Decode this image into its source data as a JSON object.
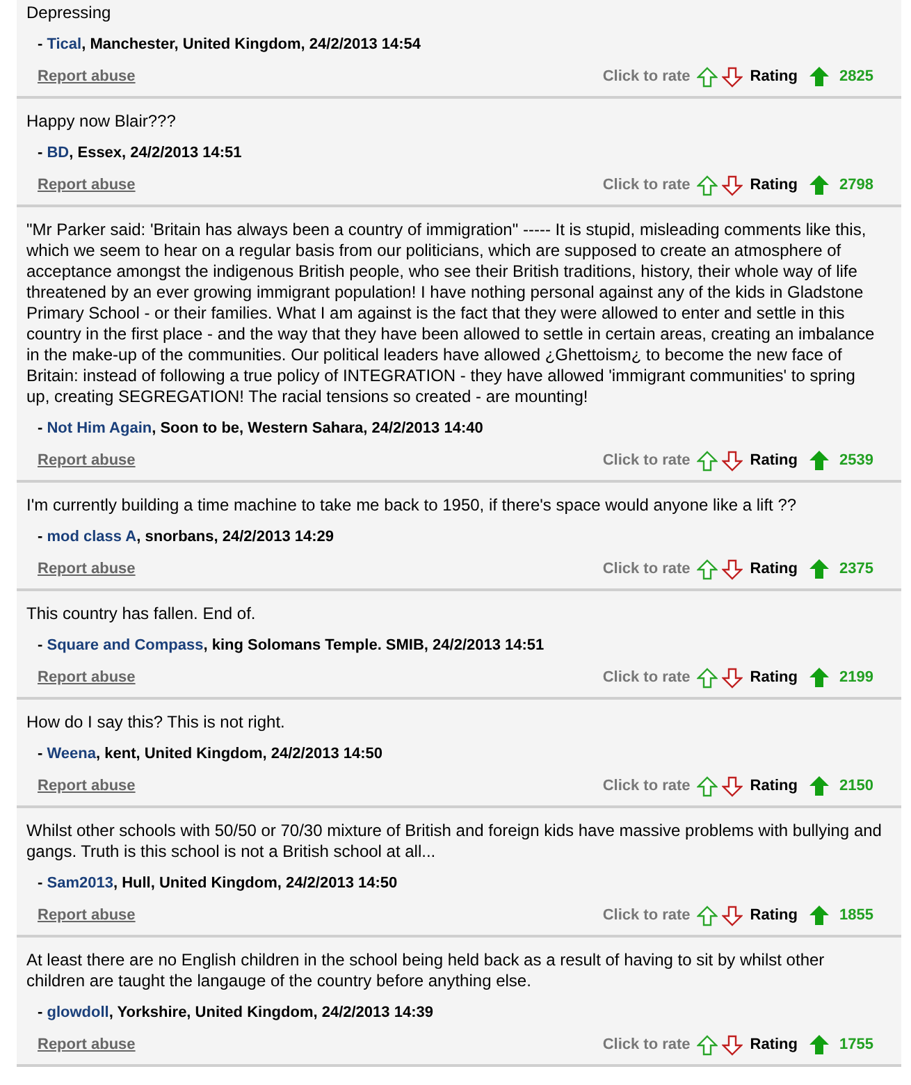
{
  "comments": [
    {
      "dash": "-",
      "text": "Depressing",
      "author": "Tical",
      "details": ", Manchester, United Kingdom, 24/2/2013 14:54",
      "report": "Report abuse",
      "rate_label": "Click to rate",
      "rating_label": "Rating",
      "rating": "2825"
    },
    {
      "dash": "-",
      "text": "Happy now Blair???",
      "author": "BD",
      "details": ", Essex, 24/2/2013 14:51",
      "report": "Report abuse",
      "rate_label": "Click to rate",
      "rating_label": "Rating",
      "rating": "2798"
    },
    {
      "dash": "-",
      "text": "\"Mr Parker said: 'Britain has always been a country of immigration\" ----- It is stupid, misleading comments like this, which we seem to hear on a regular basis from our politicians, which are supposed to create an atmosphere of acceptance amongst the indigenous British people, who see their British traditions, history, their whole way of life threatened by an ever growing immigrant population! I have nothing personal against any of the kids in Gladstone Primary School - or their families. What I am against is the fact that they were allowed to enter and settle in this country in the first place - and the way that they have been allowed to settle in certain areas, creating an imbalance in the make-up of the communities. Our political leaders have allowed ¿Ghettoism¿ to become the new face of Britain: instead of following a true policy of INTEGRATION - they have allowed 'immigrant communities' to spring up, creating SEGREGATION! The racial tensions so created - are mounting!",
      "author": "Not Him Again",
      "details": ", Soon to be, Western Sahara, 24/2/2013 14:40",
      "report": "Report abuse",
      "rate_label": "Click to rate",
      "rating_label": "Rating",
      "rating": "2539"
    },
    {
      "dash": "-",
      "text": "I'm currently building a time machine to take me back to 1950, if there's space would anyone like a lift ??",
      "author": "mod class A",
      "details": ", snorbans, 24/2/2013 14:29",
      "report": "Report abuse",
      "rate_label": "Click to rate",
      "rating_label": "Rating",
      "rating": "2375"
    },
    {
      "dash": "-",
      "text": "This country has fallen. End of.",
      "author": "Square and Compass",
      "details": ", king Solomans Temple. SMIB, 24/2/2013 14:51",
      "report": "Report abuse",
      "rate_label": "Click to rate",
      "rating_label": "Rating",
      "rating": "2199"
    },
    {
      "dash": "-",
      "text": "How do I say this? This is not right.",
      "author": "Weena",
      "details": ", kent, United Kingdom, 24/2/2013 14:50",
      "report": "Report abuse",
      "rate_label": "Click to rate",
      "rating_label": "Rating",
      "rating": "2150"
    },
    {
      "dash": "-",
      "text": "Whilst other schools with 50/50 or 70/30 mixture of British and foreign kids have massive problems with bullying and gangs. Truth is this school is not a British school at all...",
      "author": "Sam2013",
      "details": ", Hull, United Kingdom, 24/2/2013 14:50",
      "report": "Report abuse",
      "rate_label": "Click to rate",
      "rating_label": "Rating",
      "rating": "1855"
    },
    {
      "dash": "-",
      "text": "At least there are no English children in the school being held back as a result of having to sit by whilst other children are taught the langauge of the country before anything else.",
      "author": "glowdoll",
      "details": ", Yorkshire, United Kingdom, 24/2/2013 14:39",
      "report": "Report abuse",
      "rate_label": "Click to rate",
      "rating_label": "Rating",
      "rating": "1755"
    }
  ]
}
